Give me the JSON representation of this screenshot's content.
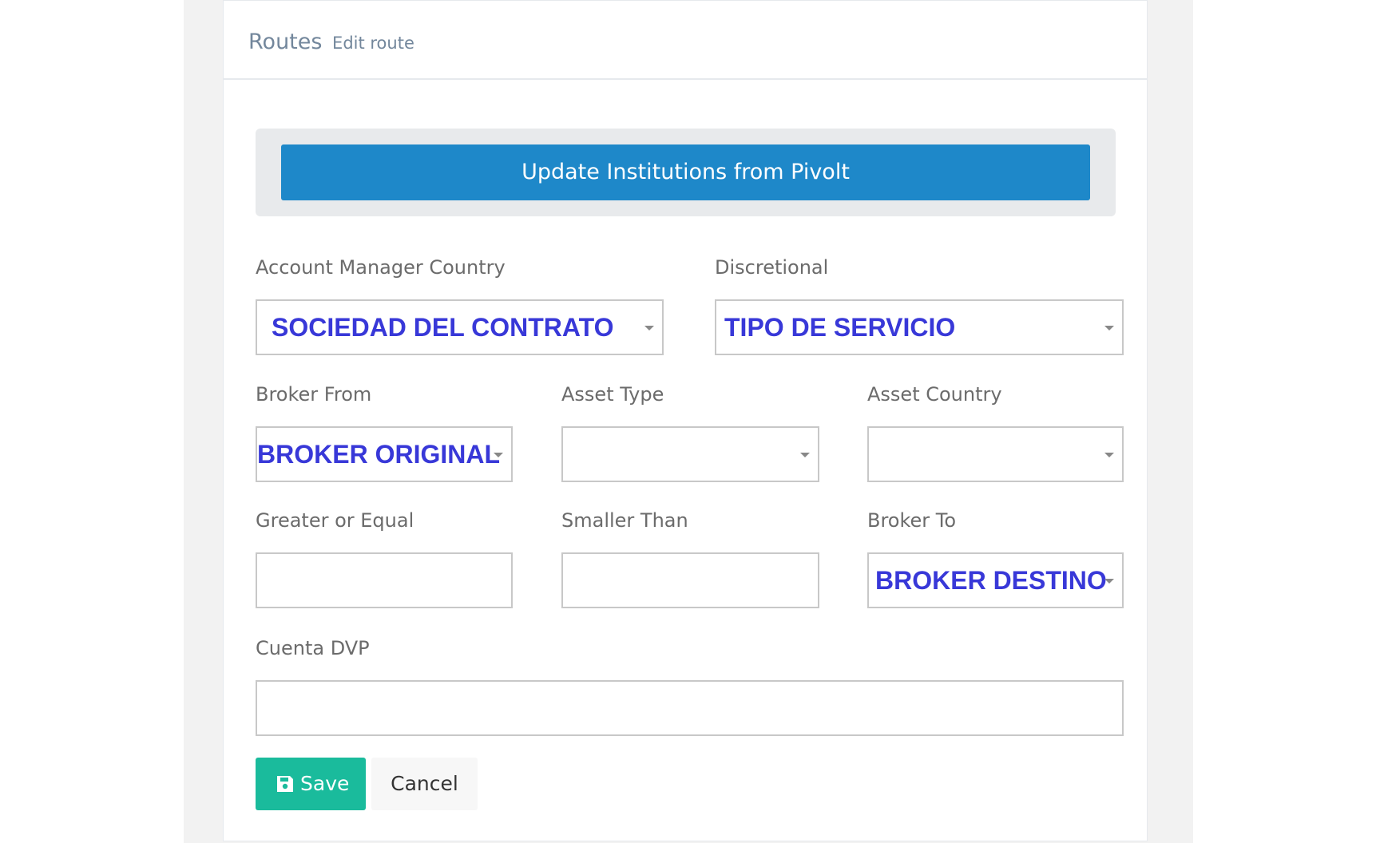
{
  "header": {
    "title": "Routes",
    "subtitle": "Edit route"
  },
  "update_button": {
    "label": "Update Institutions from Pivolt"
  },
  "form": {
    "account_manager_country": {
      "label": "Account Manager Country",
      "value": "SOCIEDAD DEL CONTRATO"
    },
    "discretional": {
      "label": "Discretional",
      "value": "TIPO DE SERVICIO"
    },
    "broker_from": {
      "label": "Broker From",
      "value": "BROKER ORIGINAL"
    },
    "asset_type": {
      "label": "Asset Type",
      "value": ""
    },
    "asset_country": {
      "label": "Asset Country",
      "value": ""
    },
    "greater_or_equal": {
      "label": "Greater or Equal",
      "value": ""
    },
    "smaller_than": {
      "label": "Smaller Than",
      "value": ""
    },
    "broker_to": {
      "label": "Broker To",
      "value": "BROKER DESTINO"
    },
    "cuenta_dvp": {
      "label": "Cuenta DVP",
      "value": ""
    }
  },
  "actions": {
    "save_label": "Save",
    "save_icon": "floppy-disk-icon",
    "cancel_label": "Cancel"
  },
  "colors": {
    "primary": "#1e88c9",
    "success": "#1abb9c",
    "value_text": "#3838d8"
  }
}
